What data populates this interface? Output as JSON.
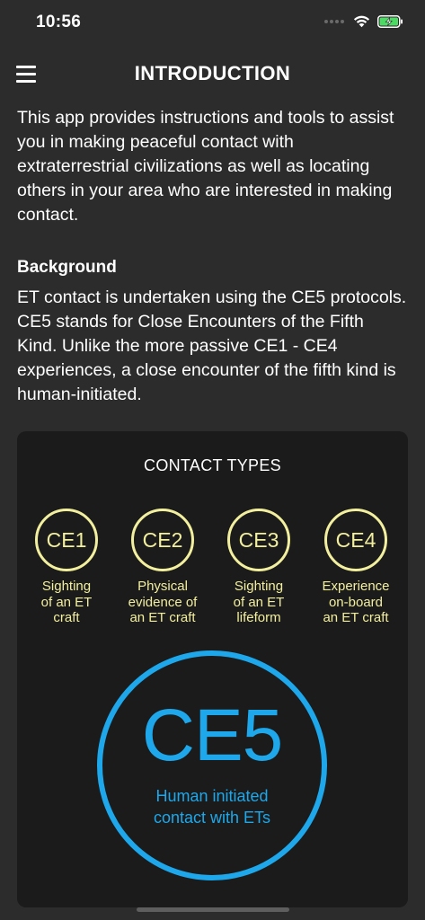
{
  "status_bar": {
    "time": "10:56"
  },
  "nav": {
    "title": "INTRODUCTION"
  },
  "intro": {
    "paragraph": "This app provides instructions and tools to assist you in making peaceful contact with extraterrestrial civilizations as well as locating others in your area who are interested in making contact."
  },
  "background": {
    "heading": "Background",
    "paragraph": "ET contact is undertaken using the CE5 protocols. CE5 stands for Close Encounters of the Fifth Kind. Unlike the more passive CE1 - CE4 experiences, a close encounter of the fifth kind is human-initiated."
  },
  "contact_types": {
    "title": "CONTACT TYPES",
    "items": [
      {
        "label": "CE1",
        "line1": "Sighting",
        "line2": "of an ET",
        "line3": "craft"
      },
      {
        "label": "CE2",
        "line1": "Physical",
        "line2": "evidence of",
        "line3": "an ET craft"
      },
      {
        "label": "CE3",
        "line1": "Sighting",
        "line2": "of an ET",
        "line3": "lifeform"
      },
      {
        "label": "CE4",
        "line1": "Experience",
        "line2": "on-board",
        "line3": "an ET craft"
      }
    ],
    "ce5": {
      "label": "CE5",
      "line1": "Human initiated",
      "line2": "contact with ETs"
    }
  },
  "colors": {
    "background": "#2c2c2c",
    "card": "#1b1b1b",
    "ce_yellow": "#f2ef9e",
    "ce5_blue": "#1ea7ea",
    "battery_green": "#4cd964"
  },
  "icons": [
    "signal-icon",
    "wifi-icon",
    "battery-charging-icon",
    "hamburger-menu-icon"
  ]
}
